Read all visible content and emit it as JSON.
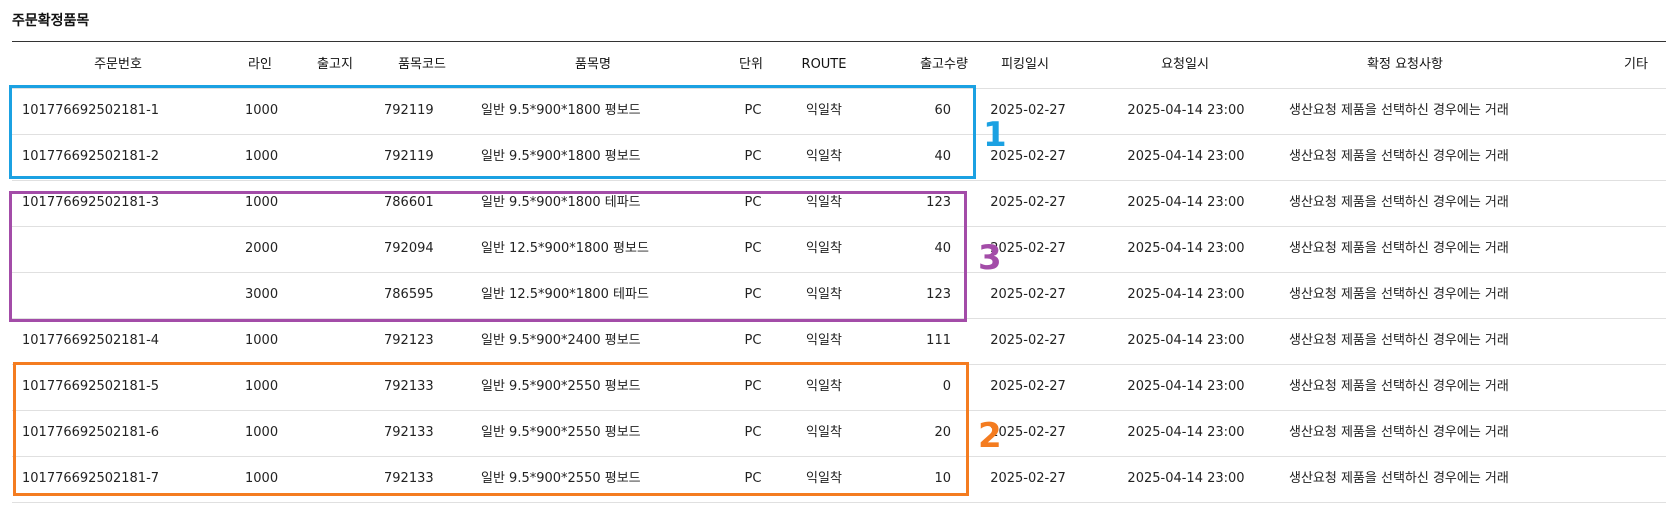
{
  "section_title": "주문확정품목",
  "columns": [
    "주문번호",
    "라인",
    "출고지",
    "품목코드",
    "품목명",
    "단위",
    "ROUTE",
    "출고수량",
    "피킹일시",
    "요청일시",
    "확정 요청사항",
    "기타"
  ],
  "rows": [
    {
      "order": "101776692502181-1",
      "line": "1000",
      "warehouse": "",
      "code": "792119",
      "name": "일반 9.5*900*1800 평보드",
      "unit": "PC",
      "route": "익일착",
      "qty": "60",
      "picking": "2025-02-27",
      "request": "2025-04-14 23:00",
      "note": "생산요청 제품을 선택하신 경우에는 거래",
      "etc": ""
    },
    {
      "order": "101776692502181-2",
      "line": "1000",
      "warehouse": "",
      "code": "792119",
      "name": "일반 9.5*900*1800 평보드",
      "unit": "PC",
      "route": "익일착",
      "qty": "40",
      "picking": "2025-02-27",
      "request": "2025-04-14 23:00",
      "note": "생산요청 제품을 선택하신 경우에는 거래",
      "etc": ""
    },
    {
      "order": "101776692502181-3",
      "line": "1000",
      "warehouse": "",
      "code": "786601",
      "name": "일반 9.5*900*1800 테파드",
      "unit": "PC",
      "route": "익일착",
      "qty": "123",
      "picking": "2025-02-27",
      "request": "2025-04-14 23:00",
      "note": "생산요청 제품을 선택하신 경우에는 거래",
      "etc": ""
    },
    {
      "order": "",
      "line": "2000",
      "warehouse": "",
      "code": "792094",
      "name": "일반 12.5*900*1800 평보드",
      "unit": "PC",
      "route": "익일착",
      "qty": "40",
      "picking": "2025-02-27",
      "request": "2025-04-14 23:00",
      "note": "생산요청 제품을 선택하신 경우에는 거래",
      "etc": ""
    },
    {
      "order": "",
      "line": "3000",
      "warehouse": "",
      "code": "786595",
      "name": "일반 12.5*900*1800 테파드",
      "unit": "PC",
      "route": "익일착",
      "qty": "123",
      "picking": "2025-02-27",
      "request": "2025-04-14 23:00",
      "note": "생산요청 제품을 선택하신 경우에는 거래",
      "etc": ""
    },
    {
      "order": "101776692502181-4",
      "line": "1000",
      "warehouse": "",
      "code": "792123",
      "name": "일반 9.5*900*2400 평보드",
      "unit": "PC",
      "route": "익일착",
      "qty": "111",
      "picking": "2025-02-27",
      "request": "2025-04-14 23:00",
      "note": "생산요청 제품을 선택하신 경우에는 거래",
      "etc": ""
    },
    {
      "order": "101776692502181-5",
      "line": "1000",
      "warehouse": "",
      "code": "792133",
      "name": "일반 9.5*900*2550 평보드",
      "unit": "PC",
      "route": "익일착",
      "qty": "0",
      "picking": "2025-02-27",
      "request": "2025-04-14 23:00",
      "note": "생산요청 제품을 선택하신 경우에는 거래",
      "etc": ""
    },
    {
      "order": "101776692502181-6",
      "line": "1000",
      "warehouse": "",
      "code": "792133",
      "name": "일반 9.5*900*2550 평보드",
      "unit": "PC",
      "route": "익일착",
      "qty": "20",
      "picking": "2025-02-27",
      "request": "2025-04-14 23:00",
      "note": "생산요청 제품을 선택하신 경우에는 거래",
      "etc": ""
    },
    {
      "order": "101776692502181-7",
      "line": "1000",
      "warehouse": "",
      "code": "792133",
      "name": "일반 9.5*900*2550 평보드",
      "unit": "PC",
      "route": "익일착",
      "qty": "10",
      "picking": "2025-02-27",
      "request": "2025-04-14 23:00",
      "note": "생산요청 제품을 선택하신 경우에는 거래",
      "etc": ""
    }
  ],
  "annotations": [
    {
      "label": "1",
      "color": "#1ba1e2"
    },
    {
      "label": "3",
      "color": "#a34ca8"
    },
    {
      "label": "2",
      "color": "#f47c20"
    }
  ]
}
